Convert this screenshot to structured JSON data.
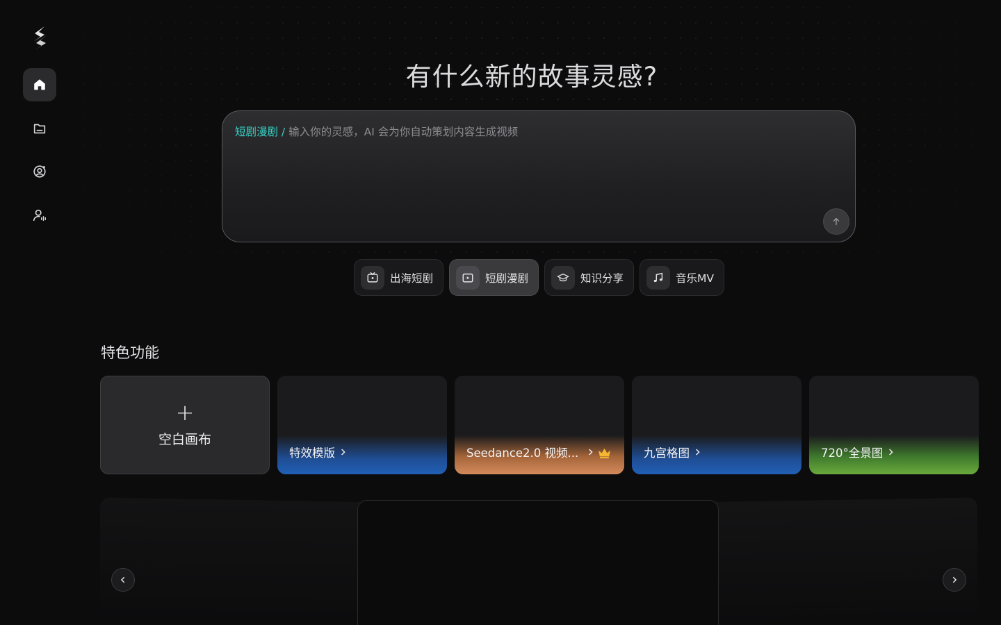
{
  "headline": "有什么新的故事灵感?",
  "prompt": {
    "tag": "短剧漫剧 /",
    "placeholder": "输入你的灵感，AI 会为你自动策划内容生成视频"
  },
  "modes": [
    {
      "label": "出海短剧",
      "icon": "tv-icon",
      "active": false
    },
    {
      "label": "短剧漫剧",
      "icon": "tv-icon",
      "active": true
    },
    {
      "label": "知识分享",
      "icon": "graduation-cap-icon",
      "active": false
    },
    {
      "label": "音乐MV",
      "icon": "music-note-icon",
      "active": false
    }
  ],
  "sidebar": {
    "items": [
      "home-icon",
      "folder-icon",
      "user-circle-icon",
      "user-voice-icon"
    ]
  },
  "features": {
    "title": "特色功能",
    "blank_card": {
      "plus": "+",
      "label": "空白画布"
    },
    "cards": [
      {
        "label": "特效模版",
        "accent": "#2160b5"
      },
      {
        "label": "Seedance2.0 视频...",
        "accent": "#d48b5c"
      },
      {
        "label": "九宫格图",
        "accent": "#2160b5"
      },
      {
        "label": "720°全景图",
        "accent": "#6aaa3c"
      }
    ]
  },
  "colors": {
    "tag": "#36d3c5",
    "crown": "#f5b731"
  }
}
